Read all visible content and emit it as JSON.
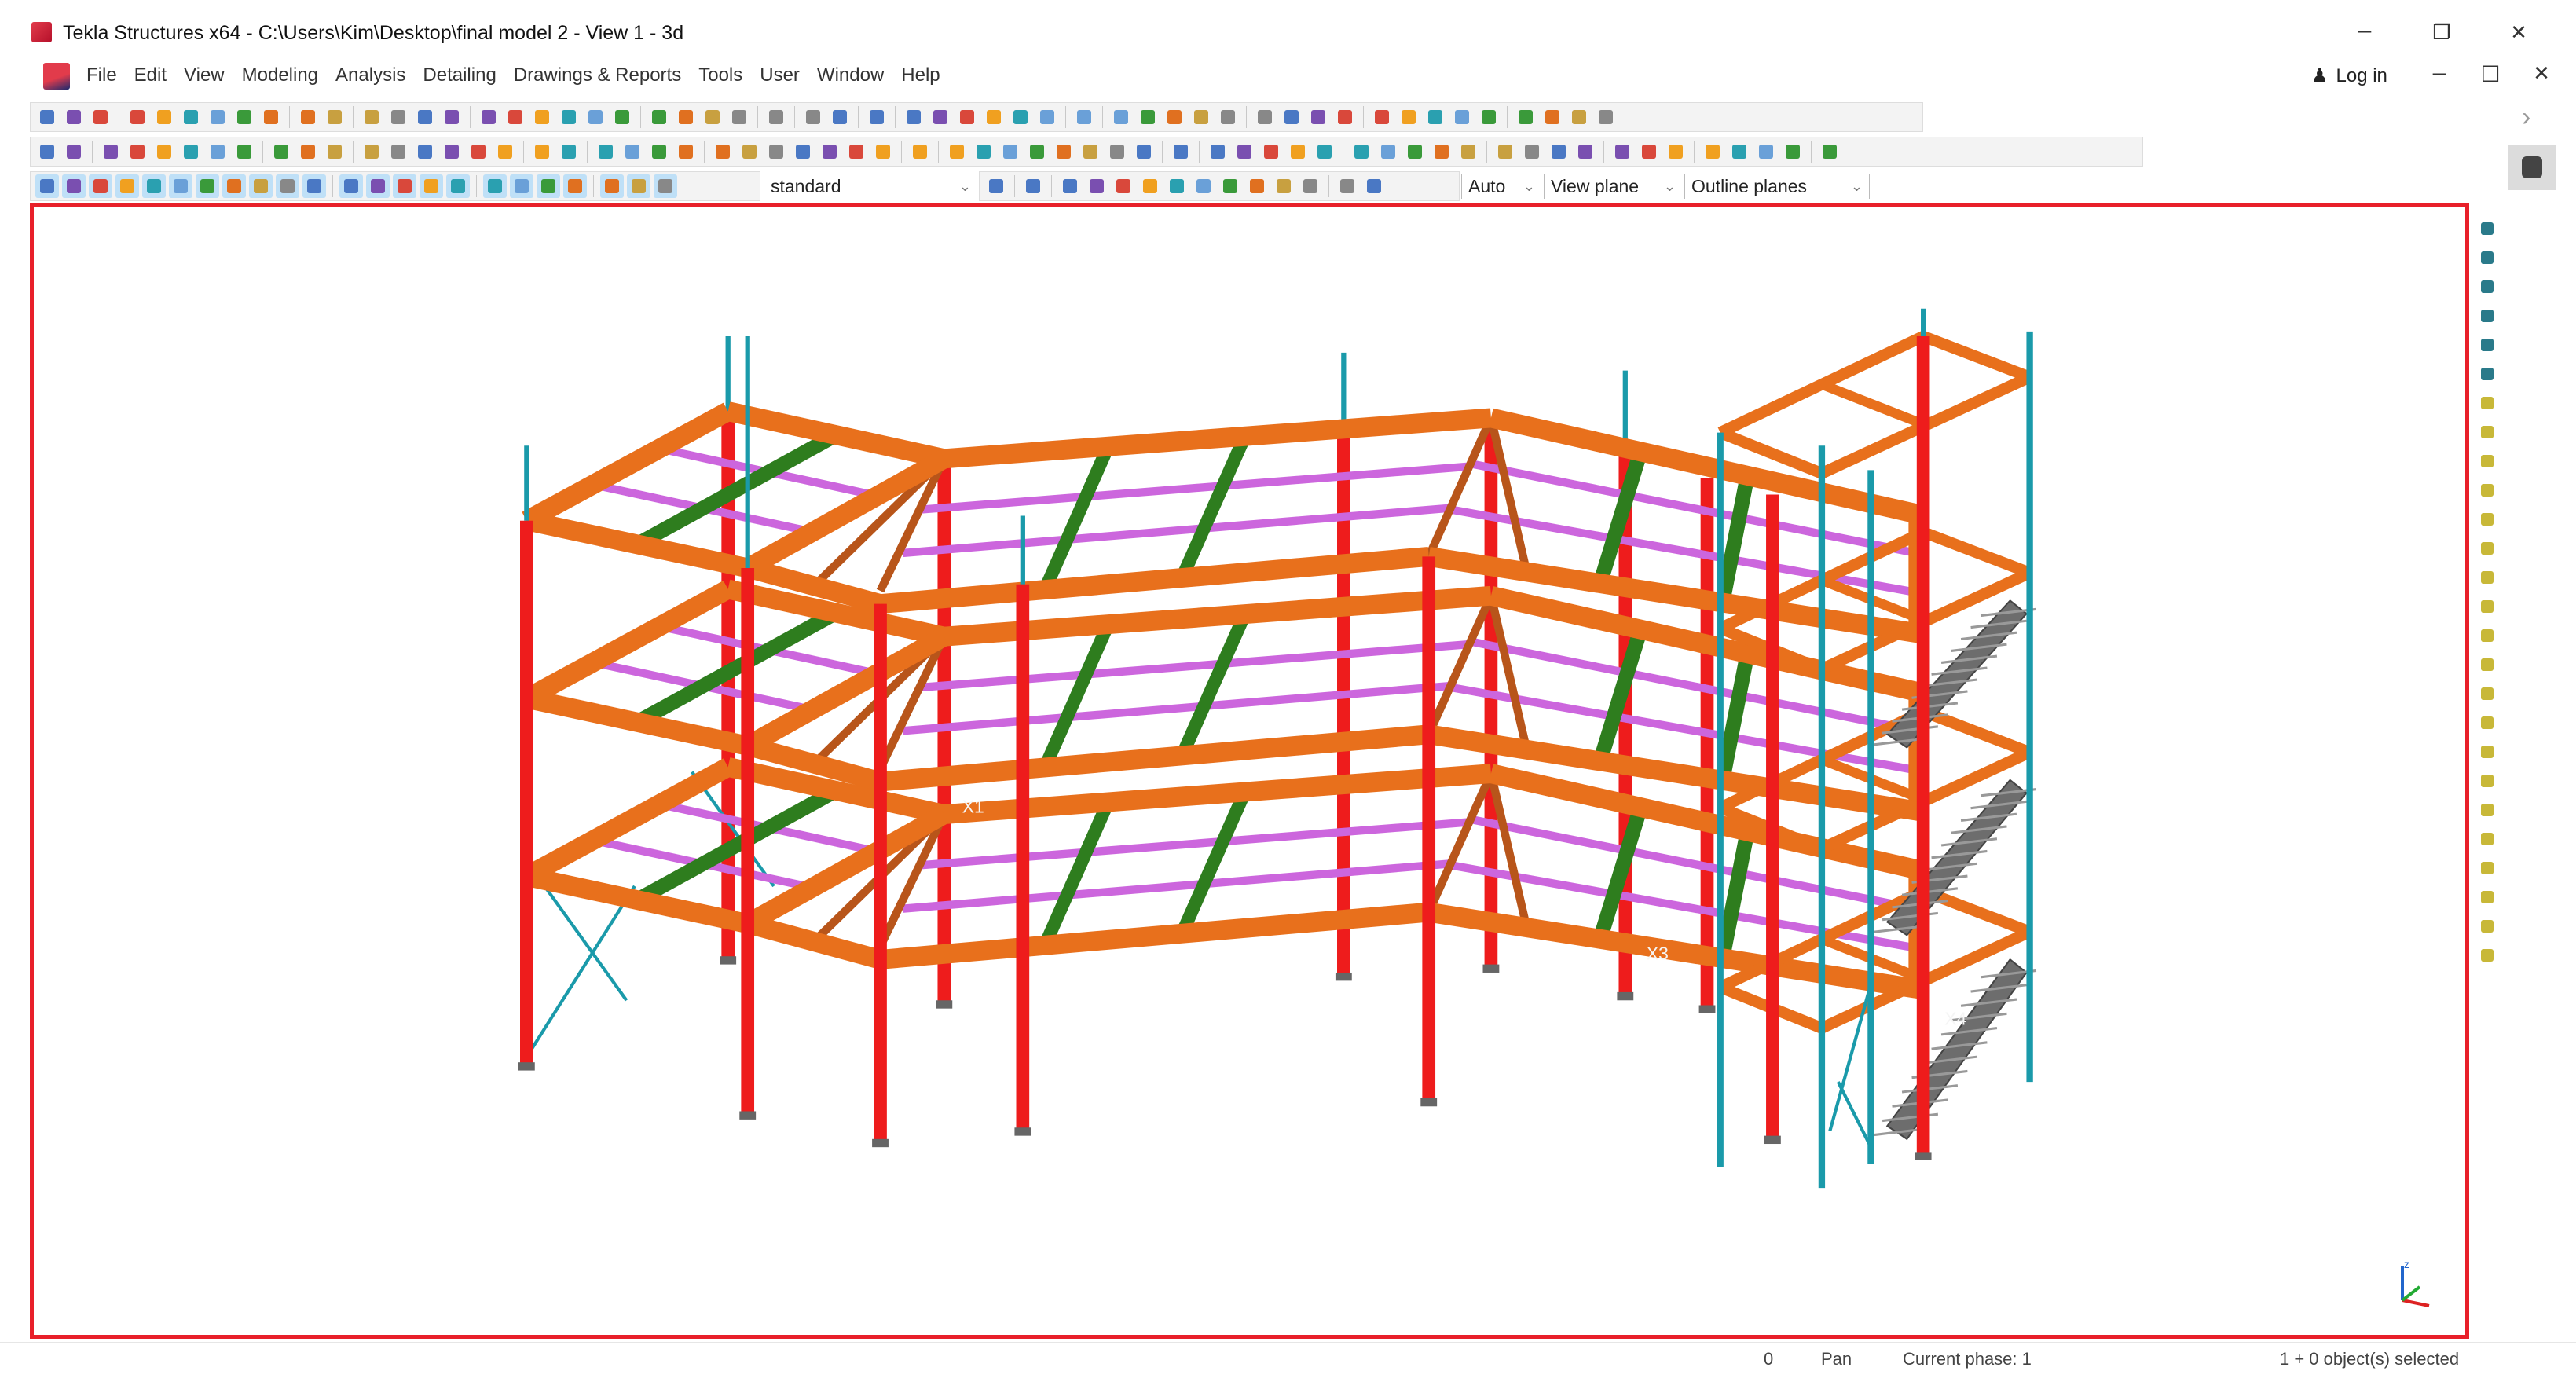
{
  "window": {
    "title": "Tekla Structures x64 - C:\\Users\\Kim\\Desktop\\final model 2  - View 1 - 3d",
    "minimize": "–",
    "restore": "❐",
    "close": "✕"
  },
  "menu": {
    "items": [
      "File",
      "Edit",
      "View",
      "Modeling",
      "Analysis",
      "Detailing",
      "Drawings & Reports",
      "Tools",
      "User",
      "Window",
      "Help"
    ],
    "login_label": "Log in",
    "doc_minimize": "–",
    "doc_restore": "☐",
    "doc_close": "✕"
  },
  "toolbar": {
    "filter_select": "standard",
    "snap_mode_select": "Auto",
    "plane_select": "View plane",
    "planes_display_select": "Outline planes"
  },
  "side_panel": {
    "expand": "›"
  },
  "statusbar": {
    "value": "0",
    "mode": "Pan",
    "phase": "Current phase: 1",
    "selection": "1 + 0 object(s) selected"
  },
  "model_labels": {
    "grid_x1": "X1",
    "grid_x3": "X3",
    "grid_x4": "X4"
  },
  "colors": {
    "viewport_border": "#e8202a",
    "column": "#ee1c1c",
    "beam": "#e8701c",
    "joist": "#cc66dd",
    "secondary_beam": "#2e7d1e",
    "brace": "#1a9aaa",
    "stair": "#6d6d6d"
  }
}
